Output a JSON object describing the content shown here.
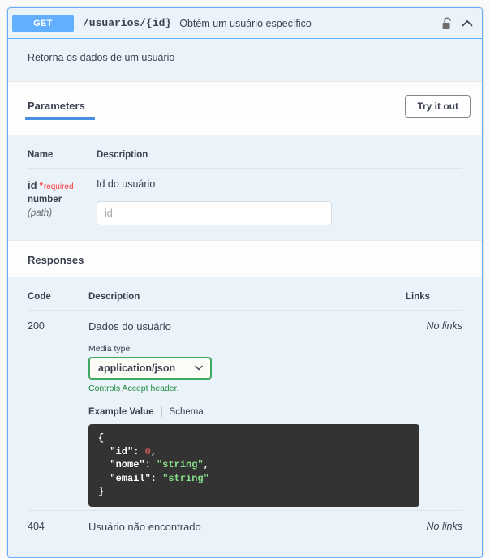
{
  "operation": {
    "method": "GET",
    "path": "/usuarios/{id}",
    "summary": "Obtém um usuário específico",
    "description": "Retorna os dados de um usuário",
    "lock_icon": "unlocked-padlock-icon",
    "collapse_icon": "chevron-up-icon",
    "accent_color": "#61affe"
  },
  "parameters_section": {
    "title": "Parameters",
    "try_it_out_label": "Try it out",
    "headers": {
      "name": "Name",
      "description": "Description"
    },
    "rows": [
      {
        "name": "id",
        "required_marker": "*",
        "required_label": "required",
        "type": "number",
        "location": "(path)",
        "description": "Id do usuário",
        "input_value": "",
        "input_placeholder": "id"
      }
    ]
  },
  "responses_section": {
    "title": "Responses",
    "headers": {
      "code": "Code",
      "description": "Description",
      "links": "Links"
    },
    "rows": [
      {
        "code": "200",
        "description": "Dados do usuário",
        "links": "No links",
        "media_type_label": "Media type",
        "media_type_value": "application/json",
        "media_type_hint": "Controls Accept header.",
        "dropdown_icon": "chevron-down-icon",
        "example_tab_label": "Example Value",
        "schema_tab_label": "Schema",
        "example_lines": [
          {
            "indent": 0,
            "text": "{"
          },
          {
            "indent": 1,
            "key": "\"id\"",
            "value": "0",
            "value_type": "number",
            "comma": ","
          },
          {
            "indent": 1,
            "key": "\"nome\"",
            "value": "\"string\"",
            "value_type": "string",
            "comma": ","
          },
          {
            "indent": 1,
            "key": "\"email\"",
            "value": "\"string\"",
            "value_type": "string",
            "comma": ""
          },
          {
            "indent": 0,
            "text": "}"
          }
        ]
      },
      {
        "code": "404",
        "description": "Usuário não encontrado",
        "links": "No links"
      }
    ]
  },
  "colors": {
    "method_blue": "#61affe",
    "panel_bg": "#ebf3fa",
    "required_red": "#f93e3e",
    "media_green": "#41a85f",
    "json_string_green": "#88e08a",
    "json_number_red": "#d15b5b"
  }
}
